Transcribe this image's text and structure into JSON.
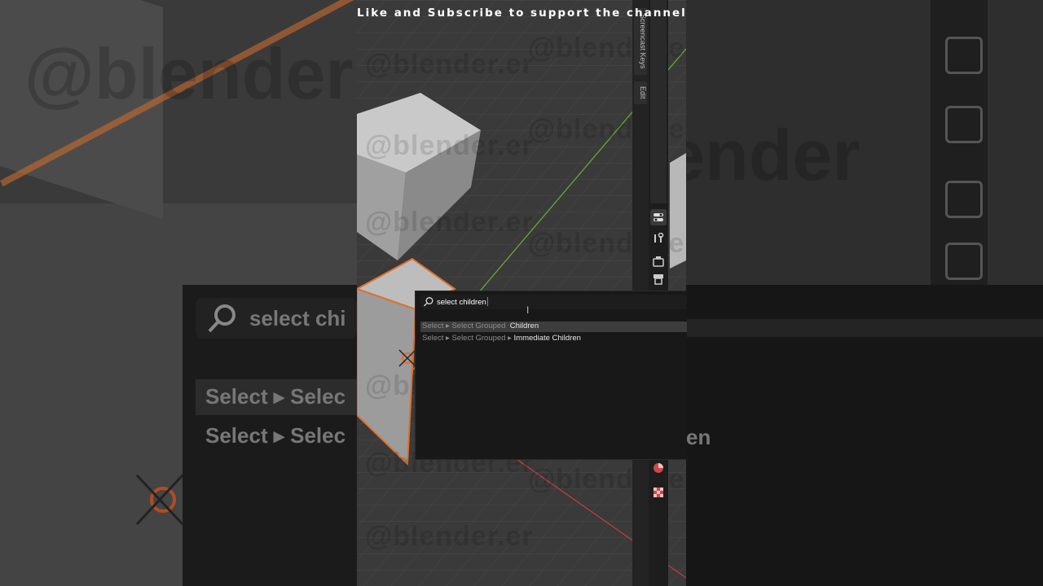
{
  "caption": "Like and Subscribe to support the channel",
  "watermark": "@blender.er",
  "npanel": {
    "tabs": [
      "Screencast Keys",
      "Edit"
    ],
    "icons": [
      "tool-icon",
      "wrench-icon",
      "render-icon",
      "output-icon",
      "material-icon",
      "texture-icon"
    ]
  },
  "search": {
    "query": "select children",
    "results": [
      {
        "path": "Select ▸ Select Grouped",
        "name": "Children",
        "selected": true
      },
      {
        "path": "Select ▸ Select Grouped ▸",
        "name": "Immediate Children",
        "selected": false
      }
    ]
  },
  "background_ghost": {
    "search_text": "select chi",
    "row1": "Select ▸ Selec",
    "row2": "Select ▸ Selec",
    "right_text": "en",
    "watermark_left": "@blender",
    "watermark_right": "@blender"
  },
  "colors": {
    "selection_outline": "#e0702a",
    "y_axis": "#6aa832",
    "x_axis": "#c2384c",
    "cursor": "#4b8bf5"
  }
}
